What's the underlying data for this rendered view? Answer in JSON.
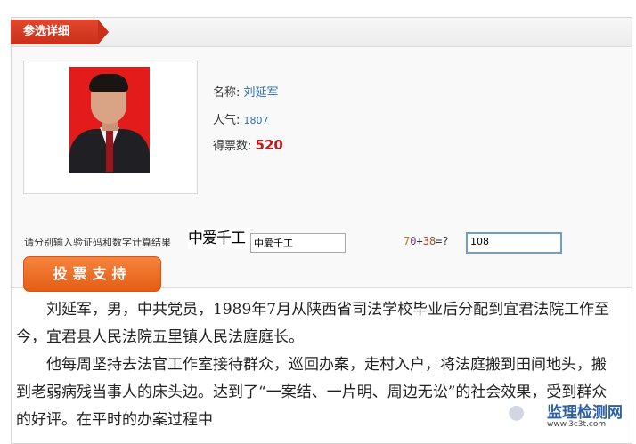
{
  "tab_title": "参选详细",
  "candidate": {
    "name_label": "名称:",
    "name": "刘延军",
    "popularity_label": "人气:",
    "popularity": "1807",
    "votes_label": "得票数:",
    "votes": "520"
  },
  "captcha": {
    "label": "请分别输入验证码和数字计算结果",
    "image_text": "中爱千工",
    "input_value": "中爱千工",
    "math_expr": {
      "a1": "7",
      "a2": "0",
      "op": "+",
      "b1": "3",
      "b2": "8",
      "eq": "=?"
    },
    "math_answer": "108"
  },
  "vote_button": "投票支持",
  "bio": [
    "刘延军，男，中共党员，1989年7月从陕西省司法学校毕业后分配到宜君法院工作至今，宜君县人民法院五里镇人民法庭庭长。",
    "他每周坚持去法官工作室接待群众，巡回办案，走村入户，将法庭搬到田间地头，搬到老弱病残当事人的床头边。达到了“一案结、一片明、周边无讼”的社会效果，受到群众的好评。在平时的办案过程中"
  ],
  "watermark": {
    "title": "监理检测网",
    "url": "www.3c3t.com"
  },
  "colors": {
    "accent": "#c9301a",
    "button": "#e35e15",
    "votes": "#c4161c",
    "link": "#2a6fb0"
  }
}
